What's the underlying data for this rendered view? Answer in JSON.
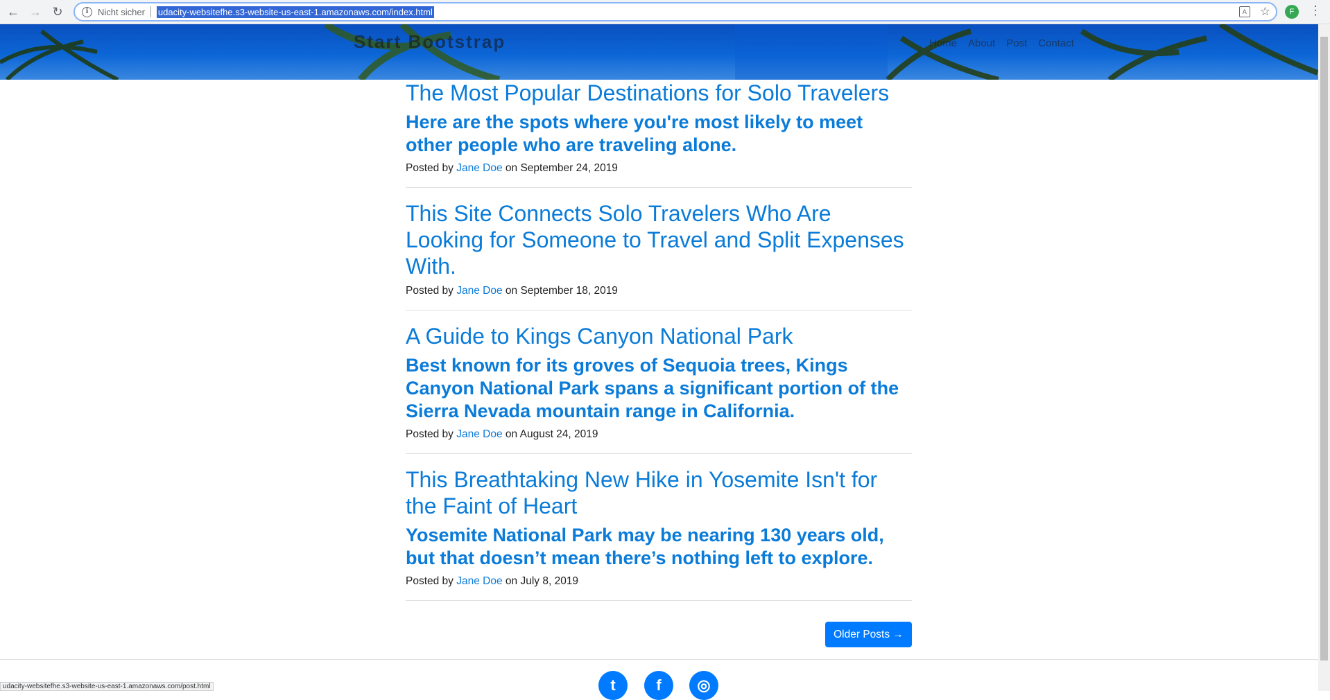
{
  "browser": {
    "security_label": "Nicht sicher",
    "url": "udacity-websitefhe.s3-website-us-east-1.amazonaws.com/index.html",
    "profile_initial": "F",
    "icons": [
      "back-icon",
      "forward-icon",
      "reload-icon",
      "info-icon",
      "translate-icon",
      "star-icon",
      "menu-icon"
    ]
  },
  "header": {
    "brand": "Start Bootstrap",
    "nav": [
      "Home",
      "About",
      "Post",
      "Contact"
    ]
  },
  "posts": [
    {
      "title": "The Most Popular Destinations for Solo Travelers",
      "subtitle": "Here are the spots where you're most likely to meet other people who are traveling alone.",
      "posted_by": "Posted by",
      "author": "Jane Doe",
      "date": "on September 24, 2019"
    },
    {
      "title": "This Site Connects Solo Travelers Who Are Looking for Someone to Travel and Split Expenses With.",
      "subtitle": "",
      "posted_by": "Posted by",
      "author": "Jane Doe",
      "date": "on September 18, 2019"
    },
    {
      "title": "A Guide to Kings Canyon National Park",
      "subtitle": "Best known for its groves of Sequoia trees, Kings Canyon National Park spans a significant portion of the Sierra Nevada mountain range in California.",
      "posted_by": "Posted by",
      "author": "Jane Doe",
      "date": "on August 24, 2019"
    },
    {
      "title": "This Breathtaking New Hike in Yosemite Isn't for the Faint of Heart",
      "subtitle": "Yosemite National Park may be nearing 130 years old, but that doesn’t mean there’s nothing left to explore.",
      "posted_by": "Posted by",
      "author": "Jane Doe",
      "date": "on July 8, 2019"
    }
  ],
  "pager": {
    "older_label": "Older Posts →"
  },
  "footer": {
    "social_icons": [
      "twitter-icon",
      "facebook-icon",
      "github-icon"
    ]
  },
  "status_bar": {
    "text": "udacity-websitefhe.s3-website-us-east-1.amazonaws.com/post.html"
  },
  "colors": {
    "accent": "#0a7bd8",
    "button": "#007bff"
  }
}
